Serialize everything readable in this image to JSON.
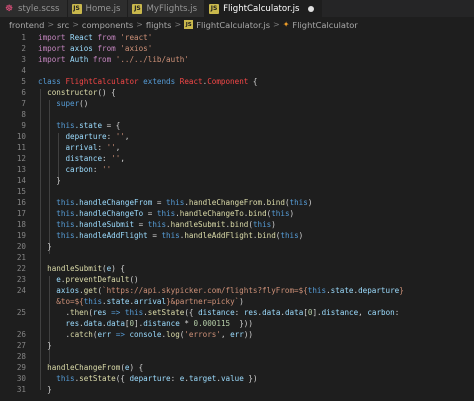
{
  "tabs": [
    {
      "label": "style.scss",
      "icon": "sass-file-icon",
      "active": false
    },
    {
      "label": "Home.js",
      "icon": "js-file-icon",
      "active": false
    },
    {
      "label": "MyFlights.js",
      "icon": "js-file-icon",
      "active": false
    },
    {
      "label": "FlightCalculator.js",
      "icon": "js-file-icon",
      "active": true,
      "modified": true
    }
  ],
  "breadcrumb": {
    "items": [
      "frontend",
      "src",
      "components",
      "flights",
      "FlightCalculator.js",
      "FlightCalculator"
    ],
    "separator": ">"
  },
  "lines": [
    {
      "n": "1"
    },
    {
      "n": "2"
    },
    {
      "n": "3"
    },
    {
      "n": "4"
    },
    {
      "n": "5"
    },
    {
      "n": "6"
    },
    {
      "n": "7"
    },
    {
      "n": "8"
    },
    {
      "n": "9"
    },
    {
      "n": "10"
    },
    {
      "n": "11"
    },
    {
      "n": "12"
    },
    {
      "n": "13"
    },
    {
      "n": "14"
    },
    {
      "n": "15"
    },
    {
      "n": "16"
    },
    {
      "n": "17"
    },
    {
      "n": "18"
    },
    {
      "n": "19"
    },
    {
      "n": "20"
    },
    {
      "n": "21"
    },
    {
      "n": "22"
    },
    {
      "n": "23"
    },
    {
      "n": "24"
    },
    {
      "n": ""
    },
    {
      "n": "25"
    },
    {
      "n": ""
    },
    {
      "n": "26"
    },
    {
      "n": "27"
    },
    {
      "n": "28"
    },
    {
      "n": "29"
    },
    {
      "n": "30"
    },
    {
      "n": "31"
    }
  ],
  "code": {
    "l1": [
      "import",
      "React",
      "from",
      "'react'"
    ],
    "l2": [
      "import",
      "axios",
      "from",
      "'axios'"
    ],
    "l3": [
      "import",
      "Auth",
      "from",
      "'../../lib/auth'"
    ],
    "l5": [
      "class",
      "FlightCalculator",
      "extends",
      "React",
      ".",
      "Component",
      " {"
    ],
    "l6": [
      "constructor",
      "() {"
    ],
    "l7": [
      "super",
      "()"
    ],
    "l9": [
      "this",
      ".state",
      " = {"
    ],
    "l10": [
      "departure",
      ": ",
      "''",
      ","
    ],
    "l11": [
      "arrival",
      ": ",
      "''",
      ","
    ],
    "l12": [
      "distance",
      ": ",
      "''",
      ","
    ],
    "l13": [
      "carbon",
      ": ",
      "''"
    ],
    "l14": [
      "}"
    ],
    "l16": [
      "this",
      ".handleChangeFrom",
      " = ",
      "this",
      ".",
      "handleChangeFrom",
      ".",
      "bind",
      "(",
      "this",
      ")"
    ],
    "l17": [
      "this",
      ".handleChangeTo",
      " = ",
      "this",
      ".",
      "handleChangeTo",
      ".",
      "bind",
      "(",
      "this",
      ")"
    ],
    "l18": [
      "this",
      ".handleSubmit",
      " = ",
      "this",
      ".",
      "handleSubmit",
      ".",
      "bind",
      "(",
      "this",
      ")"
    ],
    "l19": [
      "this",
      ".handleAddFlight",
      " = ",
      "this",
      ".",
      "handleAddFlight",
      ".",
      "bind",
      "(",
      "this",
      ")"
    ],
    "l20": [
      "}"
    ],
    "l22": [
      "handleSubmit",
      "(",
      "e",
      ") {"
    ],
    "l23": [
      "e",
      ".",
      "preventDefault",
      "()"
    ],
    "l24": [
      "axios",
      ".",
      "get",
      "(",
      "`https://api.skypicker.com/flights?flyFrom=${",
      "this",
      ".",
      "state",
      ".",
      "departure",
      "}"
    ],
    "l24b": [
      "&to=${",
      "this",
      ".",
      "state",
      ".",
      "arrival",
      "}",
      "&partner=picky`",
      ")"
    ],
    "l25": [
      ".",
      "then",
      "(",
      "res",
      " => ",
      "this",
      ".",
      "setState",
      "({ ",
      "distance",
      ": ",
      "res",
      ".",
      "data",
      ".",
      "data",
      "[",
      "0",
      "].",
      "distance",
      ", ",
      "carbon",
      ":"
    ],
    "l25b": [
      "res",
      ".",
      "data",
      ".",
      "data",
      "[",
      "0",
      "].",
      "distance",
      " * ",
      "0.000115",
      "  }))"
    ],
    "l26": [
      ".",
      "catch",
      "(",
      "err",
      " => ",
      "console",
      ".",
      "log",
      "(",
      "'errors'",
      ", ",
      "err",
      "))"
    ],
    "l27": [
      "}"
    ],
    "l29": [
      "handleChangeFrom",
      "(",
      "e",
      ") {"
    ],
    "l30": [
      "this",
      ".",
      "setState",
      "({ ",
      "departure",
      ": ",
      "e",
      ".",
      "target",
      ".",
      "value",
      " })"
    ],
    "l31": [
      "}"
    ]
  },
  "colors": {
    "background": "#1e1e1e",
    "keyword": "#c586c0",
    "string": "#ce9178",
    "function": "#dcdcaa",
    "property": "#9cdcfe",
    "class": "#4ec9b0",
    "this": "#569cd6"
  }
}
